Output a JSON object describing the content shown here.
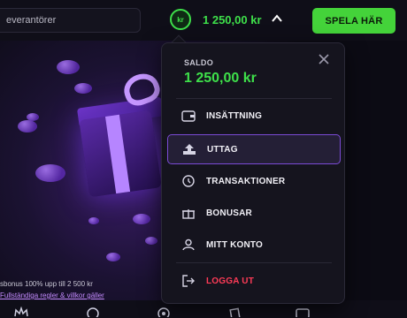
{
  "topbar": {
    "search_text": "everantörer",
    "currency_badge": "kr",
    "balance": "1 250,00 kr",
    "play_label": "SPELA HÄR"
  },
  "promo": {
    "text": "sbonus 100% upp till 2 500 kr",
    "link": "Fullständiga regler & villkor gäller"
  },
  "dropdown": {
    "saldo_label": "SALDO",
    "saldo_value": "1 250,00 kr",
    "items": [
      {
        "label": "INSÄTTNING",
        "icon": "wallet-icon"
      },
      {
        "label": "UTTAG",
        "icon": "upload-icon"
      },
      {
        "label": "TRANSAKTIONER",
        "icon": "history-icon"
      },
      {
        "label": "BONUSAR",
        "icon": "gift-icon"
      },
      {
        "label": "MITT KONTO",
        "icon": "user-icon"
      },
      {
        "label": "LOGGA UT",
        "icon": "logout-icon"
      }
    ]
  },
  "colors": {
    "accent_green": "#3ee04a",
    "logout_red": "#ff3b57",
    "highlight_purple": "#7b4bd6"
  }
}
